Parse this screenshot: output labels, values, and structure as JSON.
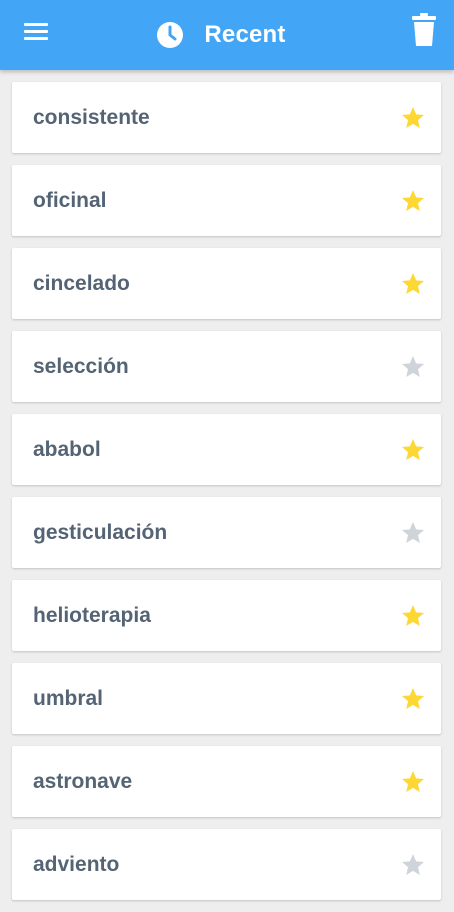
{
  "header": {
    "title": "Recent",
    "icons": {
      "menu": "hamburger-icon",
      "clock": "clock-icon",
      "trash": "trash-icon"
    }
  },
  "colors": {
    "app_bar": "#42a5f5",
    "star_active": "#fdd835",
    "star_inactive": "#cfd4da",
    "word_text": "#546474"
  },
  "items": [
    {
      "word": "consistente",
      "starred": true
    },
    {
      "word": "oficinal",
      "starred": true
    },
    {
      "word": "cincelado",
      "starred": true
    },
    {
      "word": "selección",
      "starred": false
    },
    {
      "word": "ababol",
      "starred": true
    },
    {
      "word": "gesticulación",
      "starred": false
    },
    {
      "word": "helioterapia",
      "starred": true
    },
    {
      "word": "umbral",
      "starred": true
    },
    {
      "word": "astronave",
      "starred": true
    },
    {
      "word": "adviento",
      "starred": false
    }
  ]
}
